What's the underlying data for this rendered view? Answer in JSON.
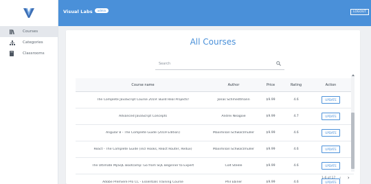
{
  "app": {
    "brand": "Visual Labs",
    "badge": "admin",
    "logout_label": "LOGOUT",
    "accent_color": "#4a90d9"
  },
  "sidebar": {
    "items": [
      {
        "label": "Courses",
        "icon": "books-icon"
      },
      {
        "label": "Categories",
        "icon": "sitemap-icon"
      },
      {
        "label": "Classrooms",
        "icon": "book-icon"
      }
    ]
  },
  "main": {
    "title": "All Courses",
    "search": {
      "placeholder": "Search",
      "icon": "search-icon"
    }
  },
  "table": {
    "headers": [
      "Course name",
      "Author",
      "Price",
      "Rating",
      "Action"
    ],
    "rows": [
      {
        "name": "The Complete JavaScript Course 2019: Build Real Projects!",
        "author": "Jonas Schmedtmann",
        "price": "$9.99",
        "rating": "4.6",
        "action": "UPDATE"
      },
      {
        "name": "Advanced JavaScript Concepts",
        "author": "Andrei Neagoie",
        "price": "$9.99",
        "rating": "4.7",
        "action": "UPDATE"
      },
      {
        "name": "Angular 8 - The Complete Guide (2019 Edition)",
        "author": "Maximilian Schwarzmüller",
        "price": "$9.99",
        "rating": "4.6",
        "action": "UPDATE"
      },
      {
        "name": "React - The Complete Guide (incl Hooks, React Router, Redux)",
        "author": "Maximilian Schwarzmüller",
        "price": "$9.99",
        "rating": "4.6",
        "action": "UPDATE"
      },
      {
        "name": "The Ultimate MySQL Bootcamp: Go from SQL Beginner to Expert",
        "author": "Colt Steele",
        "price": "$9.99",
        "rating": "4.6",
        "action": "UPDATE"
      },
      {
        "name": "Adobe Premiere Pro CC - Essentials Training Course",
        "author": "Phil Ebiner",
        "price": "$9.99",
        "rating": "4.6",
        "action": "UPDATE"
      }
    ]
  },
  "pagination": {
    "text": "1-6 of 17",
    "prev_icon": "chevron-left-icon",
    "next_icon": "chevron-right-icon"
  }
}
